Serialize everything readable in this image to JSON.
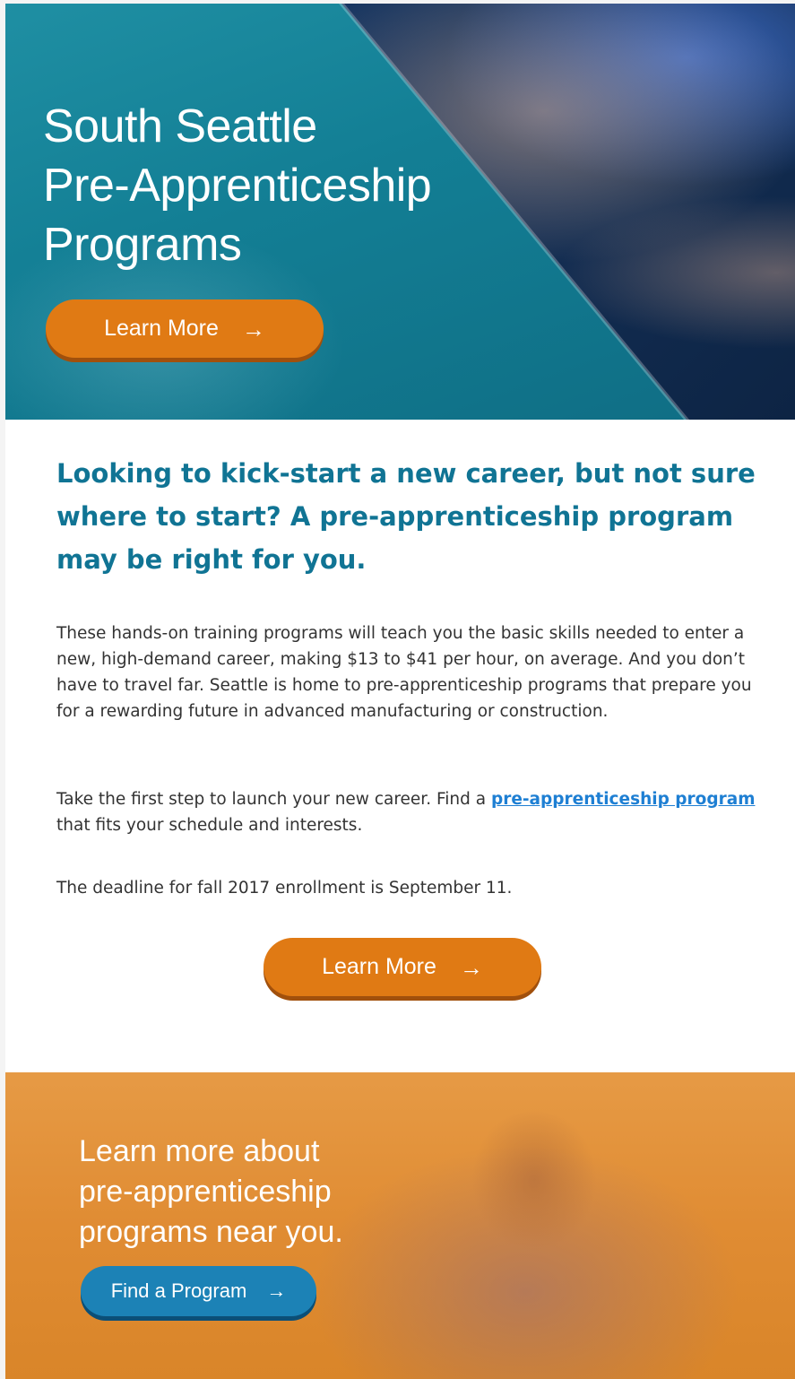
{
  "hero": {
    "title": "South Seattle\nPre-Apprenticeship\nPrograms",
    "button_label": "Learn More",
    "button_arrow": "→"
  },
  "main": {
    "headline": "Looking to kick-start a new career, but not sure where to start? A pre-apprenticeship program may be right for you.",
    "paragraph1": "These hands-on training programs will teach you the basic skills needed to enter a new, high-demand career, making $13 to $41 per hour, on average. And you don’t have to travel far. Seattle is home to pre-apprenticeship programs that prepare you for a rewarding future in advanced manufacturing or construction.",
    "paragraph2_before": "Take the first step to launch your new career. Find a ",
    "paragraph2_link": "pre-apprenticeship program",
    "paragraph2_after": " that fits your schedule and interests.",
    "paragraph3": "The deadline for fall 2017 enrollment is September 11.",
    "button_label": "Learn More",
    "button_arrow": "→"
  },
  "footer": {
    "title": "Learn more about\npre-apprenticeship\nprograms near you.",
    "button_label": "Find a Program",
    "button_arrow": "→"
  },
  "colors": {
    "hero_teal": "#137f95",
    "headline_blue": "#107494",
    "button_orange": "#e07a14",
    "button_blue": "#1c82b6",
    "footer_orange": "#e08c33",
    "link_blue": "#1e7fd3"
  }
}
